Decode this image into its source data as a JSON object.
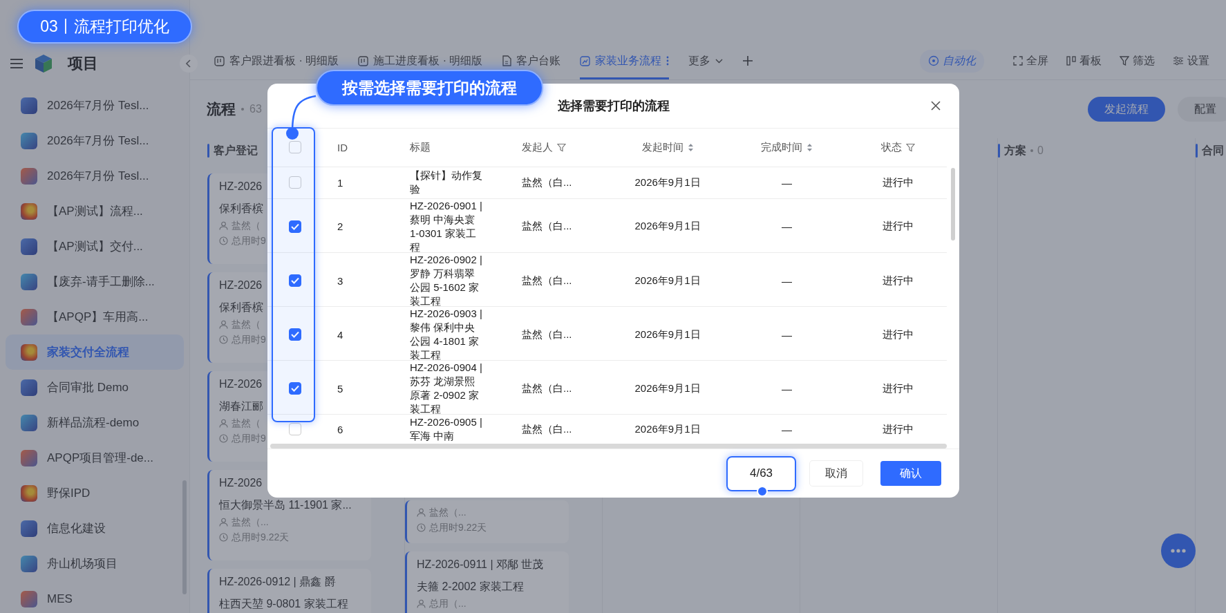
{
  "section_badge": "03丨流程打印优化",
  "hint_callout": "按需选择需要打印的流程",
  "sidebar": {
    "title": "项目",
    "items": [
      {
        "label": "2026年7月份 Tesl...",
        "selected": false
      },
      {
        "label": "2026年7月份 Tesl...",
        "selected": false
      },
      {
        "label": "2026年7月份 Tesl...",
        "selected": false
      },
      {
        "label": "【AP测试】流程...",
        "selected": false
      },
      {
        "label": "【AP测试】交付...",
        "selected": false
      },
      {
        "label": "【废弃-请手工删除...",
        "selected": false
      },
      {
        "label": "【APQP】车用高...",
        "selected": false
      },
      {
        "label": "家装交付全流程",
        "selected": true
      },
      {
        "label": "合同审批 Demo",
        "selected": false
      },
      {
        "label": "新样品流程-demo",
        "selected": false
      },
      {
        "label": "APQP项目管理-de...",
        "selected": false
      },
      {
        "label": "野保IPD",
        "selected": false
      },
      {
        "label": "信息化建设",
        "selected": false
      },
      {
        "label": "舟山机场项目",
        "selected": false
      },
      {
        "label": "MES",
        "selected": false
      }
    ]
  },
  "tabs": [
    {
      "label": "客户跟进看板 · 明细版",
      "kind": "board",
      "selected": false
    },
    {
      "label": "施工进度看板 · 明细版",
      "kind": "board",
      "selected": false
    },
    {
      "label": "客户台账",
      "kind": "ledger",
      "selected": false
    },
    {
      "label": "家装业务流程",
      "kind": "flow",
      "selected": true
    },
    {
      "label": "更多",
      "kind": "more",
      "selected": false
    }
  ],
  "toolbar": [
    {
      "label": "自动化",
      "kind": "automation"
    },
    {
      "label": "全屏",
      "kind": "fullscreen"
    },
    {
      "label": "看板",
      "kind": "board"
    },
    {
      "label": "筛选",
      "kind": "filter"
    },
    {
      "label": "设置",
      "kind": "settings"
    }
  ],
  "header": {
    "title": "流程",
    "count": "63",
    "actions": [
      {
        "label": "发起流程",
        "kind": "primary"
      },
      {
        "label": "配置",
        "kind": "secondary"
      }
    ]
  },
  "board": {
    "columns": [
      {
        "title": "客户登记",
        "cards": [
          {
            "title_lines": [
              "HZ-2026",
              "保利香槟"
            ],
            "person": "盐然（",
            "duration": "总用时9"
          },
          {
            "title_lines": [
              "HZ-2026",
              "保利香槟"
            ],
            "person": "盐然（",
            "duration": "总用时9"
          },
          {
            "title_lines": [
              "HZ-2026",
              "湖春江郦"
            ],
            "person": "盐然（",
            "duration": "总用时9"
          },
          {
            "title_lines": [
              "HZ-2026",
              "恒大御景半岛 11-1901 家..."
            ],
            "person": "盐然（...",
            "duration": "总用时9.22天"
          },
          {
            "title_lines": [
              "HZ-2026-0912 | 鼎鑫 爵",
              "柱西天堃 9-0801 家装工程"
            ]
          }
        ]
      },
      {
        "cards": [
          {
            "person": "盐然（...",
            "duration": "总用时9.22天"
          },
          {
            "title_lines": [
              "HZ-2026-0911 | 邓鄅 世茂",
              "夫箍 2-2002 家装工程"
            ],
            "person": "总用（..."
          }
        ]
      },
      {},
      {},
      {
        "title": "方案",
        "count": "0"
      },
      {
        "title": "合同"
      }
    ]
  },
  "dialog": {
    "title": "选择需要打印的流程",
    "select_all_checked": false,
    "columns": [
      {
        "label": "ID",
        "kind": "plain"
      },
      {
        "label": "标题",
        "kind": "plain"
      },
      {
        "label": "发起人",
        "kind": "filter"
      },
      {
        "label": "发起时间",
        "kind": "sort"
      },
      {
        "label": "完成时间",
        "kind": "sort"
      },
      {
        "label": "状态",
        "kind": "filter"
      }
    ],
    "rows": [
      {
        "checked": false,
        "id": "1",
        "title": "【探针】动作复验",
        "initiator": "盐然（白...",
        "started": "2026年9月1日",
        "finished": "—",
        "status": "进行中"
      },
      {
        "checked": true,
        "id": "2",
        "title": "HZ-2026-0901 | 蔡明 中海央寰 1-0301 家装工程",
        "initiator": "盐然（白...",
        "started": "2026年9月1日",
        "finished": "—",
        "status": "进行中"
      },
      {
        "checked": true,
        "id": "3",
        "title": "HZ-2026-0902 | 罗静 万科翡翠公园 5-1602 家装工程",
        "initiator": "盐然（白...",
        "started": "2026年9月1日",
        "finished": "—",
        "status": "进行中"
      },
      {
        "checked": true,
        "id": "4",
        "title": "HZ-2026-0903 | 黎伟 保利中央公园 4-1801 家装工程",
        "initiator": "盐然（白...",
        "started": "2026年9月1日",
        "finished": "—",
        "status": "进行中"
      },
      {
        "checked": true,
        "id": "5",
        "title": "HZ-2026-0904 | 苏芬 龙湖景熙原著 2-0902 家装工程",
        "initiator": "盐然（白...",
        "started": "2026年9月1日",
        "finished": "—",
        "status": "进行中"
      },
      {
        "checked": false,
        "id": "6",
        "title": "HZ-2026-0905 | 军海 中南",
        "initiator": "盐然（白...",
        "started": "2026年9月1日",
        "finished": "—",
        "status": "进行中"
      }
    ],
    "counter": "4/63",
    "buttons": [
      {
        "label": "取消",
        "kind": "secondary"
      },
      {
        "label": "确认",
        "kind": "primary"
      }
    ]
  }
}
